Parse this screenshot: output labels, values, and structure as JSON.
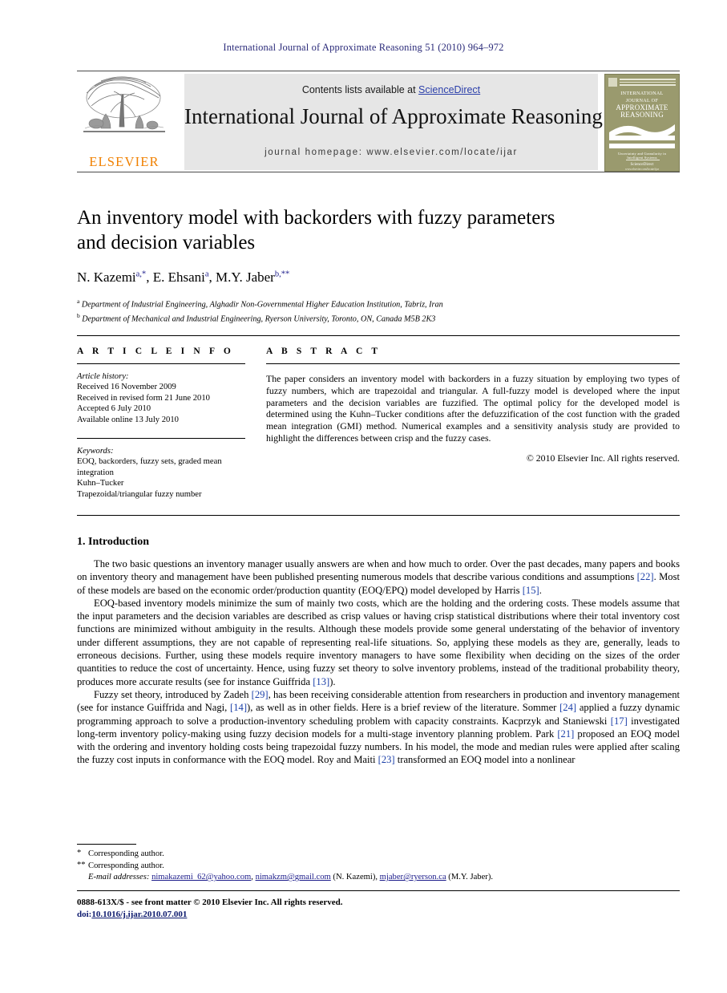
{
  "running_head": "International Journal of Approximate Reasoning 51 (2010) 964–972",
  "masthead": {
    "contents_prefix": "Contents lists available at ",
    "sciencedirect": "ScienceDirect",
    "journal_title": "International Journal of Approximate Reasoning",
    "homepage": "journal homepage: www.elsevier.com/locate/ijar",
    "publisher_wordmark": "ELSEVIER",
    "cover": {
      "title_small_top": "INTERNATIONAL JOURNAL OF",
      "title_big_1": "APPROXIMATE",
      "title_big_2": "REASONING",
      "subtitle": "Uncertainty and Granularity in Intelligent Systems",
      "imprint": "ScienceDirect",
      "imprint_sub": "www.elsevier.com/locate/ijar"
    }
  },
  "article": {
    "title_line_1": "An inventory model with backorders with fuzzy parameters",
    "title_line_2": "and decision variables",
    "authors": [
      {
        "name": "N. Kazemi",
        "sup": "a,*"
      },
      {
        "name": "E. Ehsani",
        "sup": "a"
      },
      {
        "name": "M.Y. Jaber",
        "sup": "b,**"
      }
    ],
    "affiliations": [
      {
        "mark": "a",
        "text": "Department of Industrial Engineering, Alghadir Non-Governmental Higher Education Institution, Tabriz, Iran"
      },
      {
        "mark": "b",
        "text": "Department of Mechanical and Industrial Engineering, Ryerson University, Toronto, ON, Canada M5B 2K3"
      }
    ]
  },
  "info": {
    "heading": "A R T I C L E   I N F O",
    "history_label": "Article history:",
    "history": [
      "Received 16 November 2009",
      "Received in revised form 21 June 2010",
      "Accepted 6 July 2010",
      "Available online 13 July 2010"
    ],
    "keywords_label": "Keywords:",
    "keywords": [
      "EOQ, backorders, fuzzy sets, graded mean",
      "integration",
      "Kuhn–Tucker",
      "Trapezoidal/triangular fuzzy number"
    ]
  },
  "abstract": {
    "heading": "A B S T R A C T",
    "text": "The paper considers an inventory model with backorders in a fuzzy situation by employing two types of fuzzy numbers, which are trapezoidal and triangular. A full-fuzzy model is developed where the input parameters and the decision variables are fuzzified. The optimal policy for the developed model is determined using the Kuhn–Tucker conditions after the defuzzification of the cost function with the graded mean integration (GMI) method. Numerical examples and a sensitivity analysis study are provided to highlight the differences between crisp and the fuzzy cases.",
    "copyright": "© 2010 Elsevier Inc. All rights reserved."
  },
  "body": {
    "section_heading": "1. Introduction",
    "paragraphs": [
      {
        "parts": [
          {
            "t": "The two basic questions an inventory manager usually answers are when and how much to order. Over the past decades, many papers and books on inventory theory and management have been published presenting numerous models that describe various conditions and assumptions "
          },
          {
            "t": "[22]",
            "ref": true
          },
          {
            "t": ". Most of these models are based on the economic order/production quantity (EOQ/EPQ) model developed by Harris "
          },
          {
            "t": "[15]",
            "ref": true
          },
          {
            "t": "."
          }
        ]
      },
      {
        "parts": [
          {
            "t": "EOQ-based inventory models minimize the sum of mainly two costs, which are the holding and the ordering costs. These models assume that the input parameters and the decision variables are described as crisp values or having crisp statistical distributions where their total inventory cost functions are minimized without ambiguity in the results. Although these models provide some general understating of the behavior of inventory under different assumptions, they are not capable of representing real-life situations. So, applying these models as they are, generally, leads to erroneous decisions. Further, using these models require inventory managers to have some flexibility when deciding on the sizes of the order quantities to reduce the cost of uncertainty. Hence, using fuzzy set theory to solve inventory problems, instead of the traditional probability theory, produces more accurate results (see for instance Guiffrida "
          },
          {
            "t": "[13]",
            "ref": true
          },
          {
            "t": ")."
          }
        ]
      },
      {
        "parts": [
          {
            "t": "Fuzzy set theory, introduced by Zadeh "
          },
          {
            "t": "[29]",
            "ref": true
          },
          {
            "t": ", has been receiving considerable attention from researchers in production and inventory management (see for instance Guiffrida and Nagi, "
          },
          {
            "t": "[14]",
            "ref": true
          },
          {
            "t": "), as well as in other fields. Here is a brief review of the literature. Sommer "
          },
          {
            "t": "[24]",
            "ref": true
          },
          {
            "t": " applied a fuzzy dynamic programming approach to solve a production-inventory scheduling problem with capacity constraints. Kacprzyk and Staniewski "
          },
          {
            "t": "[17]",
            "ref": true
          },
          {
            "t": " investigated long-term inventory policy-making using fuzzy decision models for a multi-stage inventory planning problem. Park "
          },
          {
            "t": "[21]",
            "ref": true
          },
          {
            "t": " proposed an EOQ model with the ordering and inventory holding costs being trapezoidal fuzzy numbers. In his model, the mode and median rules were applied after scaling the fuzzy cost inputs in conformance with the EOQ model. Roy and Maiti "
          },
          {
            "t": "[23]",
            "ref": true
          },
          {
            "t": " transformed an EOQ model into a nonlinear"
          }
        ]
      }
    ]
  },
  "footnotes": {
    "corresponding_1_mark": "*",
    "corresponding_1": "Corresponding author.",
    "corresponding_2_mark": "**",
    "corresponding_2": "Corresponding author.",
    "email_label": "E-mail addresses:",
    "emails": [
      {
        "address": "nimakazemi_62@yahoo.com",
        "sep": ", "
      },
      {
        "address": "nimakzm@gmail.com",
        "sep": " (N. Kazemi), "
      },
      {
        "address": "mjaber@ryerson.ca",
        "sep": " (M.Y. Jaber)."
      }
    ]
  },
  "imprint": {
    "issn_line": "0888-613X/$ - see front matter © 2010 Elsevier Inc. All rights reserved.",
    "doi_prefix": "doi:",
    "doi": "10.1016/j.ijar.2010.07.001"
  }
}
